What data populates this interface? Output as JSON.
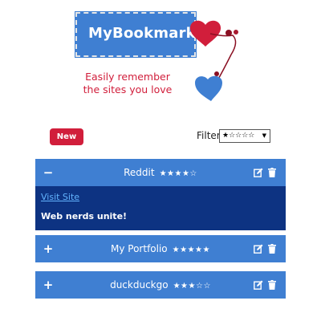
{
  "logo": {
    "title": "MyBookmarks",
    "tagline_line1": "Easily remember",
    "tagline_line2": "the sites you love"
  },
  "toolbar": {
    "new_label": "New",
    "filter_label": "Filter",
    "filter_value": "★☆☆☆☆"
  },
  "bookmarks": [
    {
      "toggle": "−",
      "title": "Reddit",
      "stars": "★★★★☆",
      "rating": 4,
      "expanded": true,
      "link_text": "Visit Site",
      "description": "Web nerds unite!"
    },
    {
      "toggle": "+",
      "title": "My Portfolio",
      "stars": "★★★★★",
      "rating": 5,
      "expanded": false
    },
    {
      "toggle": "+",
      "title": "duckduckgo",
      "stars": "★★★☆☆",
      "rating": 3,
      "expanded": false
    }
  ],
  "colors": {
    "accent_blue": "#3f7fd2",
    "dark_blue": "#0d3382",
    "brand_red": "#d11e3b",
    "link_blue": "#63b4ff"
  },
  "icons": [
    "heart-icon",
    "edit-icon",
    "trash-icon"
  ]
}
